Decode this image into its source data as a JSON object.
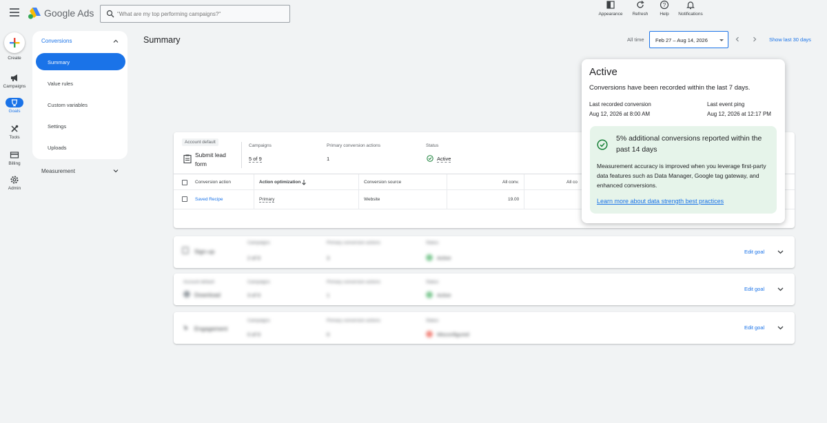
{
  "topbar": {
    "brand": "Google Ads",
    "search_placeholder": "\"What are my top performing campaigns?\"",
    "actions": [
      {
        "label": "Appearance",
        "icon": "appearance-icon"
      },
      {
        "label": "Refresh",
        "icon": "refresh-icon"
      },
      {
        "label": "Help",
        "icon": "help-icon"
      },
      {
        "label": "Notifications",
        "icon": "bell-icon"
      }
    ]
  },
  "rail": {
    "items": [
      {
        "label": "Create",
        "icon": "plus-icon"
      },
      {
        "label": "Campaigns",
        "icon": "megaphone-icon"
      },
      {
        "label": "Goals",
        "icon": "trophy-icon"
      },
      {
        "label": "Tools",
        "icon": "tools-icon"
      },
      {
        "label": "Billing",
        "icon": "card-icon"
      },
      {
        "label": "Admin",
        "icon": "gear-icon"
      }
    ]
  },
  "nav": {
    "section": "Conversions",
    "items": [
      {
        "label": "Summary",
        "active": true
      },
      {
        "label": "Value rules",
        "active": false
      },
      {
        "label": "Custom variables",
        "active": false
      },
      {
        "label": "Settings",
        "active": false
      },
      {
        "label": "Uploads",
        "active": false
      }
    ],
    "measurement": "Measurement"
  },
  "header": {
    "title": "Summary",
    "all_time": "All time",
    "date_range": "Feb 27 – Aug 14, 2026",
    "show_last": "Show last 30 days"
  },
  "goal_card": {
    "account_default": "Account default",
    "name": "Submit lead form",
    "campaigns_label": "Campaigns",
    "campaigns_value": "5 of 9",
    "primary_label": "Primary conversion actions",
    "primary_value": "1",
    "status_label": "Status",
    "status_value": "Active",
    "columns": [
      "Conversion action",
      "Action optimization",
      "Conversion source",
      "All conv.",
      "All co"
    ],
    "row": {
      "action": "Saved Recipe",
      "optimization": "Primary",
      "source": "Website",
      "all_conv": "19.00"
    }
  },
  "collapsed_goals": [
    {
      "name": "Sign-up",
      "campaigns_label": "Campaigns",
      "campaigns_value": "2 of 9",
      "primary_label": "Primary conversion actions",
      "primary_value": "3",
      "status_label": "Status",
      "status_value": "Active",
      "edit": "Edit goal"
    },
    {
      "account_default": "Account default",
      "name": "Download",
      "campaigns_label": "Campaigns",
      "campaigns_value": "3 of 9",
      "primary_label": "Primary conversion actions",
      "primary_value": "1",
      "status_label": "Status",
      "status_value": "Active",
      "edit": "Edit goal"
    },
    {
      "name": "Engagement",
      "campaigns_label": "Campaigns",
      "campaigns_value": "0 of 9",
      "primary_label": "Primary conversion actions",
      "primary_value": "0",
      "status_label": "Status",
      "status_value": "Misconfigured",
      "edit": "Edit goal"
    }
  ],
  "popover": {
    "title": "Active",
    "description": "Conversions have been recorded within the last 7 days.",
    "last_conversion_label": "Last recorded conversion",
    "last_conversion_value": "Aug 12, 2026 at 8:00 AM",
    "last_ping_label": "Last event ping",
    "last_ping_value": "Aug 12, 2026 at 12:17 PM",
    "box_title": "5% additional conversions reported within the past 14 days",
    "box_body": "Measurement accuracy is improved when you leverage first-party data features such as Data Manager, Google tag gateway, and enhanced conversions.",
    "link": "Learn more about data strength best practices"
  },
  "colors": {
    "accent": "#1a73e8",
    "success": "#188038",
    "success_bg": "#e6f4ea",
    "background": "#f1f3f4"
  }
}
